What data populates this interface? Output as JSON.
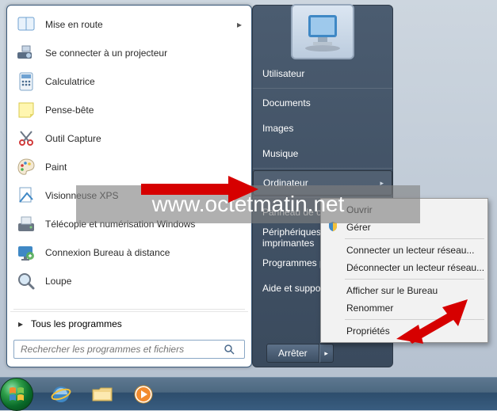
{
  "programs": [
    {
      "label": "Mise en route",
      "icon": "book",
      "has_submenu": true
    },
    {
      "label": "Se connecter à un projecteur",
      "icon": "projector"
    },
    {
      "label": "Calculatrice",
      "icon": "calculator"
    },
    {
      "label": "Pense-bête",
      "icon": "sticky"
    },
    {
      "label": "Outil Capture",
      "icon": "snip"
    },
    {
      "label": "Paint",
      "icon": "palette"
    },
    {
      "label": "Visionneuse XPS",
      "icon": "xps"
    },
    {
      "label": "Télécopie et numérisation Windows",
      "icon": "fax"
    },
    {
      "label": "Connexion Bureau à distance",
      "icon": "remote"
    },
    {
      "label": "Loupe",
      "icon": "magnifier"
    }
  ],
  "all_programs_label": "Tous les programmes",
  "search_placeholder": "Rechercher les programmes et fichiers",
  "right_panel_items": [
    "Utilisateur",
    "Documents",
    "Images",
    "Musique",
    "Ordinateur",
    "Panneau de configuration",
    "Périphériques et imprimantes",
    "Programmes par défaut",
    "Aide et support"
  ],
  "right_panel_selected": "Ordinateur",
  "context_menu": {
    "groups": [
      [
        "Ouvrir",
        "Gérer"
      ],
      [
        "Connecter un lecteur réseau...",
        "Déconnecter un lecteur réseau..."
      ],
      [
        "Afficher sur le Bureau",
        "Renommer"
      ],
      [
        "Propriétés"
      ]
    ],
    "manage_icon": "shield"
  },
  "shutdown_label": "Arrêter",
  "watermark_text": "www.octetmatin.net"
}
